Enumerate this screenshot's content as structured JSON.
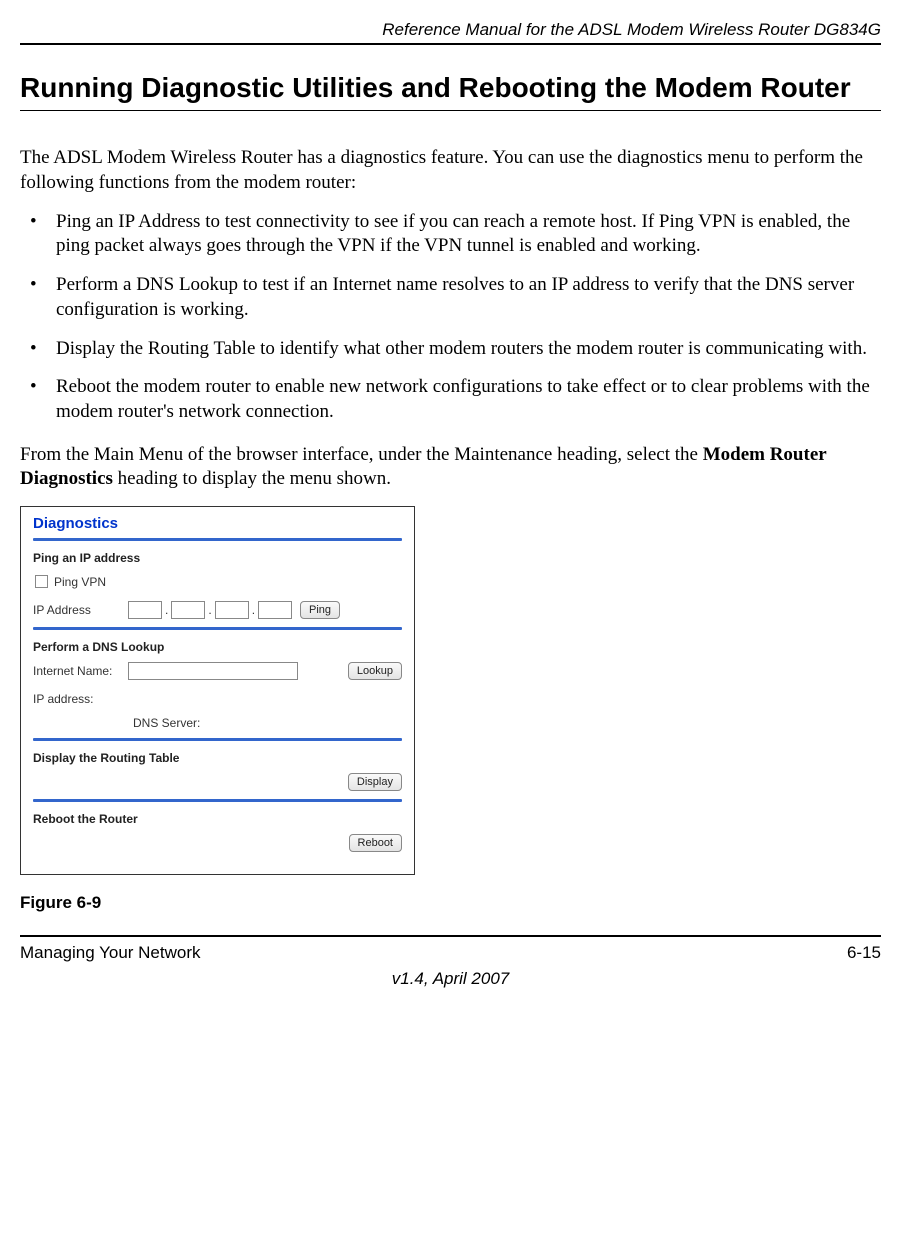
{
  "header": {
    "manual_title": "Reference Manual for the ADSL Modem Wireless Router DG834G"
  },
  "heading": "Running Diagnostic Utilities and Rebooting the Modem Router",
  "intro": "The ADSL Modem Wireless Router has a diagnostics feature. You can use the diagnostics menu to perform the following functions from the modem router:",
  "bullets": [
    "Ping an IP Address to test connectivity to see if you can reach a remote host. If Ping VPN is enabled, the ping packet always goes through the VPN if the VPN tunnel is enabled and working.",
    "Perform a DNS Lookup to test if an Internet name resolves to an IP address to verify that the DNS server configuration is working.",
    "Display the Routing Table to identify what other modem routers the modem router is communicating with.",
    "Reboot the modem router to enable new network configurations to take effect or to clear problems with the modem router's network connection."
  ],
  "post_list_pre": "From the Main Menu of the browser interface, under the Maintenance heading, select the ",
  "post_list_bold": "Modem Router Diagnostics",
  "post_list_post": " heading to display the menu shown.",
  "diag": {
    "title": "Diagnostics",
    "ping": {
      "section": "Ping an IP address",
      "vpn_label": "Ping VPN",
      "ip_label": "IP Address",
      "button": "Ping"
    },
    "dns": {
      "section": "Perform a DNS Lookup",
      "name_label": "Internet Name:",
      "ip_label": "IP address:",
      "server_label": "DNS Server:",
      "button": "Lookup"
    },
    "routing": {
      "section": "Display the Routing Table",
      "button": "Display"
    },
    "reboot": {
      "section": "Reboot the Router",
      "button": "Reboot"
    }
  },
  "figure_caption": "Figure 6-9",
  "footer": {
    "left": "Managing Your Network",
    "right": "6-15",
    "version": "v1.4, April 2007"
  }
}
